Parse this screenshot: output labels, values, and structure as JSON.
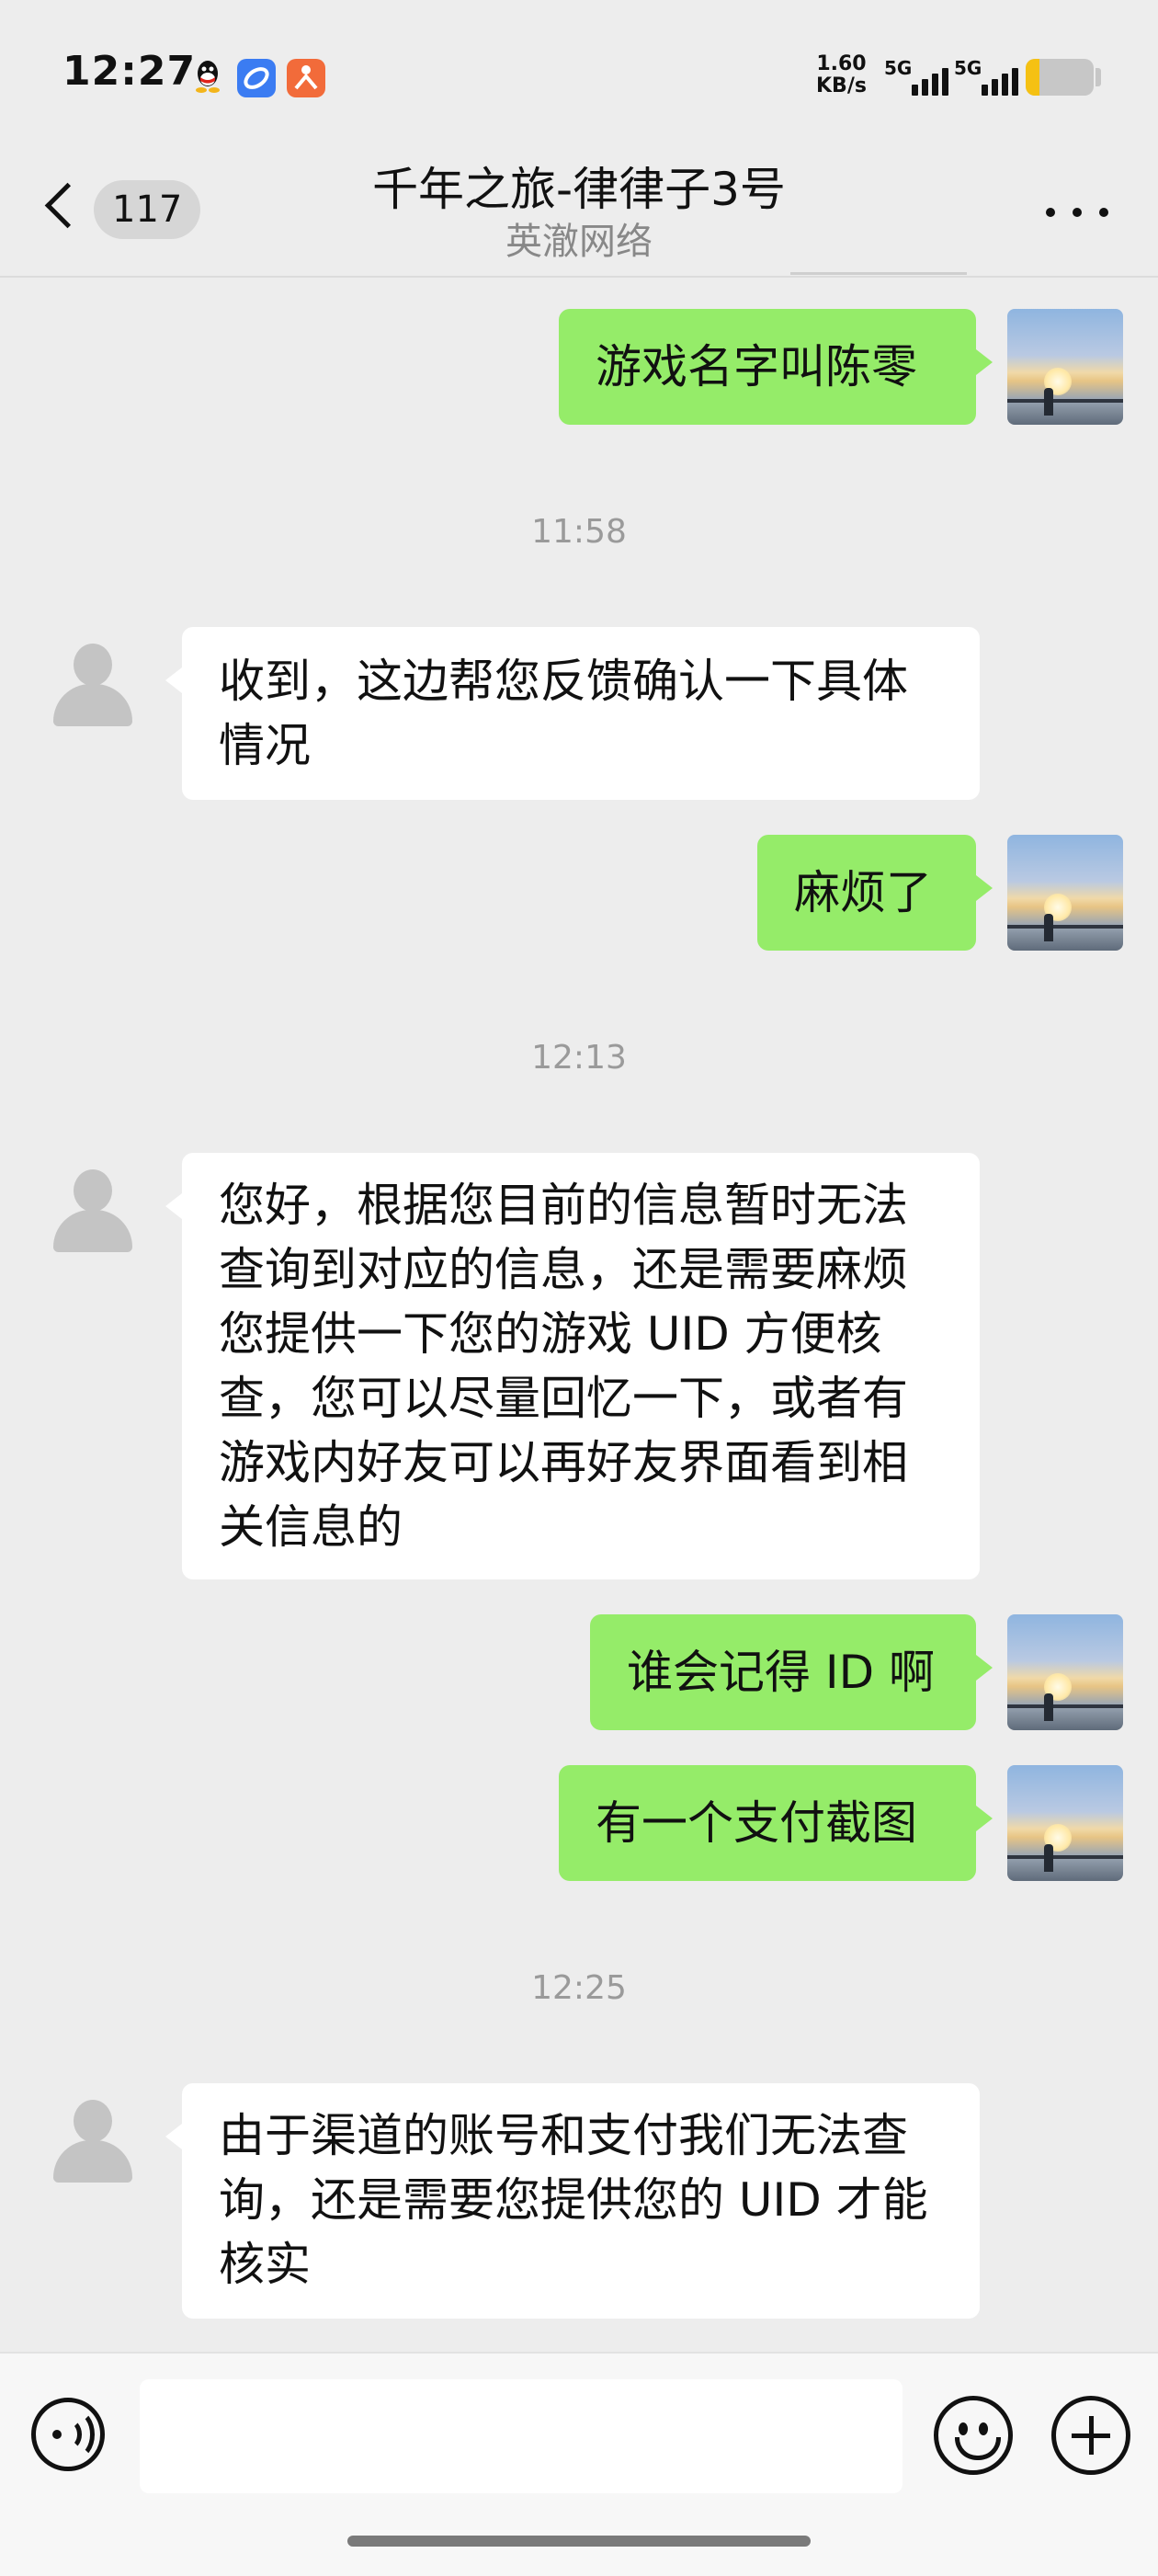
{
  "status_bar": {
    "time": "12:27",
    "net_speed_value": "1.60",
    "net_speed_unit": "KB/s",
    "signal_1": "5G",
    "signal_2": "5G",
    "battery_level": 0.2,
    "icons": [
      "qq-icon",
      "blue-app-icon",
      "orange-app-icon"
    ]
  },
  "nav": {
    "unread_count": "117",
    "title": "千年之旅-律律子3号",
    "subtitle": "英澈网络"
  },
  "messages": [
    {
      "side": "out",
      "text": "游戏名字叫陈零"
    },
    {
      "type": "timestamp",
      "text": "11:58"
    },
    {
      "side": "in",
      "text": "收到，这边帮您反馈确认一下具体情况"
    },
    {
      "side": "out",
      "text": "麻烦了"
    },
    {
      "type": "timestamp",
      "text": "12:13"
    },
    {
      "side": "in",
      "text": "您好，根据您目前的信息暂时无法查询到对应的信息，还是需要麻烦您提供一下您的游戏 UID 方便核查，您可以尽量回忆一下，或者有游戏内好友可以再好友界面看到相关信息的"
    },
    {
      "side": "out",
      "text": "谁会记得 ID 啊"
    },
    {
      "side": "out",
      "text": "有一个支付截图"
    },
    {
      "type": "timestamp",
      "text": "12:25"
    },
    {
      "side": "in",
      "text": "由于渠道的账号和支付我们无法查询，还是需要您提供您的 UID 才能核实"
    }
  ],
  "input": {
    "value": "",
    "placeholder": ""
  },
  "colors": {
    "background": "#ededed",
    "bubble_out": "#95ec69",
    "bubble_in": "#ffffff",
    "battery": "#f5c113"
  }
}
